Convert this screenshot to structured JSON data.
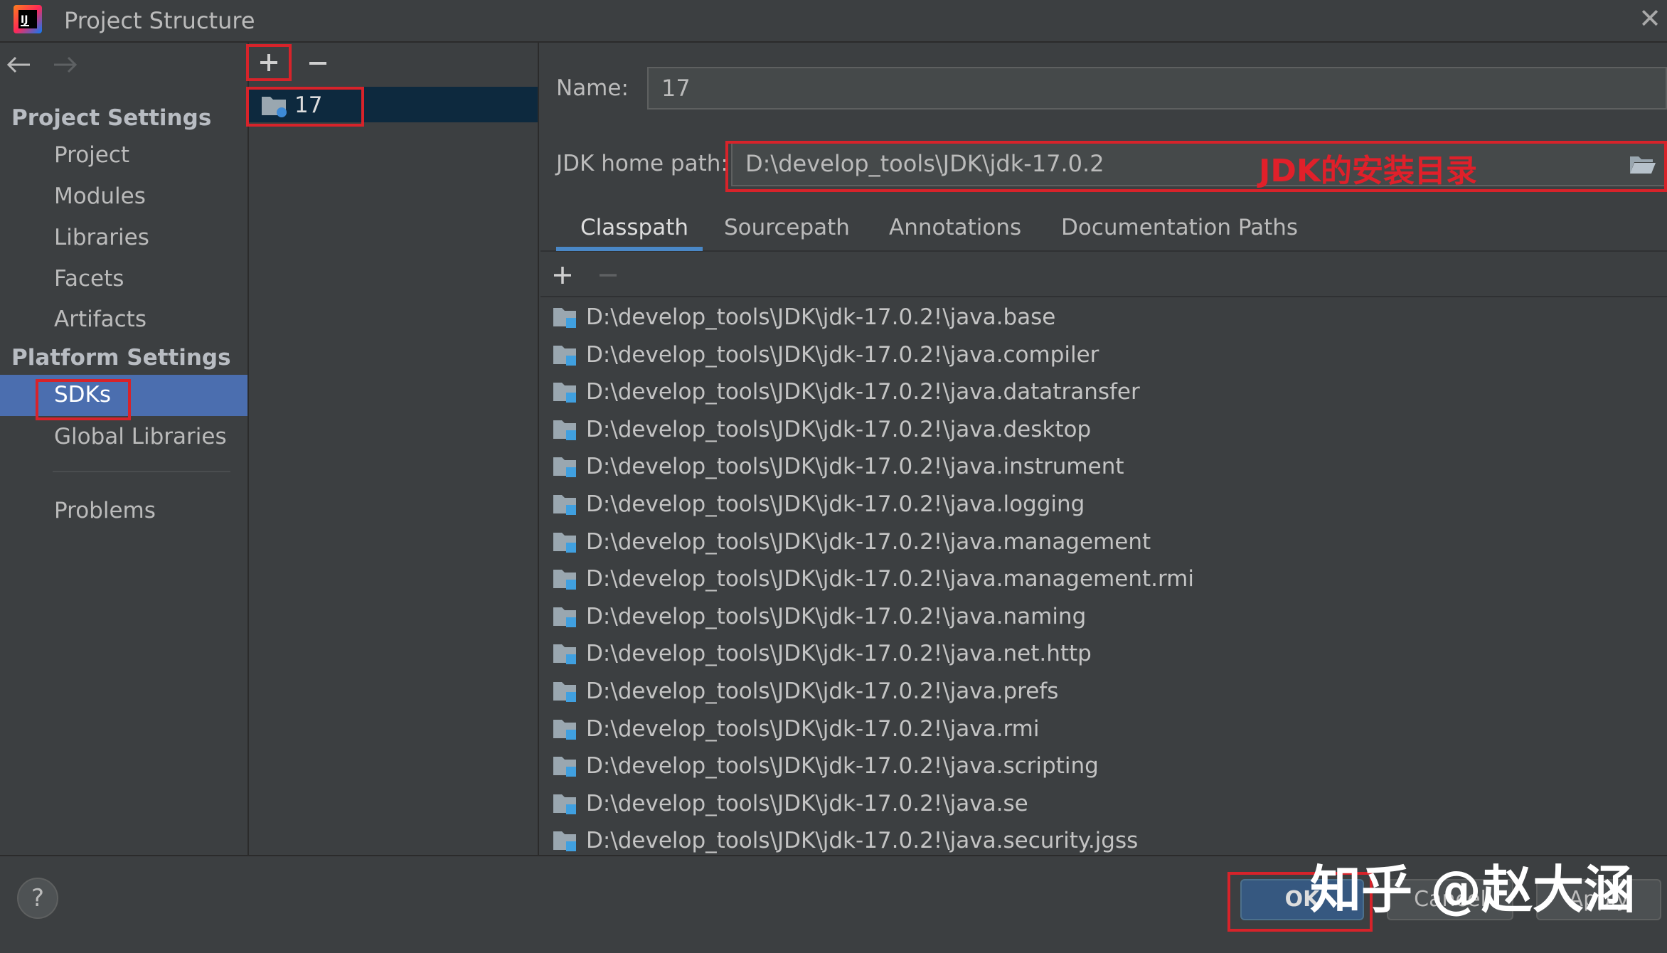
{
  "window": {
    "title": "Project Structure",
    "close_icon": "close-icon"
  },
  "nav": {
    "back_icon": "arrow-left-icon",
    "forward_icon": "arrow-right-icon"
  },
  "sidebar": {
    "project_settings_header": "Project Settings",
    "project_items": [
      "Project",
      "Modules",
      "Libraries",
      "Facets",
      "Artifacts"
    ],
    "platform_settings_header": "Platform Settings",
    "platform_items": [
      "SDKs",
      "Global Libraries"
    ],
    "problems_label": "Problems",
    "selected": "SDKs"
  },
  "sdk_list": {
    "add_icon": "plus-icon",
    "remove_icon": "minus-icon",
    "items": [
      "17"
    ]
  },
  "details": {
    "name_label": "Name:",
    "name_value": "17",
    "jdk_home_label": "JDK home path:",
    "jdk_home_value": "D:\\develop_tools\\JDK\\jdk-17.0.2",
    "annotation": "JDK的安装目录",
    "tabs": [
      "Classpath",
      "Sourcepath",
      "Annotations",
      "Documentation Paths"
    ],
    "active_tab": "Classpath",
    "classpath_entries": [
      "D:\\develop_tools\\JDK\\jdk-17.0.2!\\java.base",
      "D:\\develop_tools\\JDK\\jdk-17.0.2!\\java.compiler",
      "D:\\develop_tools\\JDK\\jdk-17.0.2!\\java.datatransfer",
      "D:\\develop_tools\\JDK\\jdk-17.0.2!\\java.desktop",
      "D:\\develop_tools\\JDK\\jdk-17.0.2!\\java.instrument",
      "D:\\develop_tools\\JDK\\jdk-17.0.2!\\java.logging",
      "D:\\develop_tools\\JDK\\jdk-17.0.2!\\java.management",
      "D:\\develop_tools\\JDK\\jdk-17.0.2!\\java.management.rmi",
      "D:\\develop_tools\\JDK\\jdk-17.0.2!\\java.naming",
      "D:\\develop_tools\\JDK\\jdk-17.0.2!\\java.net.http",
      "D:\\develop_tools\\JDK\\jdk-17.0.2!\\java.prefs",
      "D:\\develop_tools\\JDK\\jdk-17.0.2!\\java.rmi",
      "D:\\develop_tools\\JDK\\jdk-17.0.2!\\java.scripting",
      "D:\\develop_tools\\JDK\\jdk-17.0.2!\\java.se",
      "D:\\develop_tools\\JDK\\jdk-17.0.2!\\java.security.jgss"
    ]
  },
  "footer": {
    "help_label": "?",
    "ok_label": "OK",
    "cancel_label": "Cancel",
    "apply_label": "Apply",
    "watermark": "知乎 @赵大涵"
  },
  "colors": {
    "background": "#3c3f41",
    "selection": "#4b6eaf",
    "annotation_red": "#d7232a",
    "tab_underline": "#4a88c7"
  }
}
